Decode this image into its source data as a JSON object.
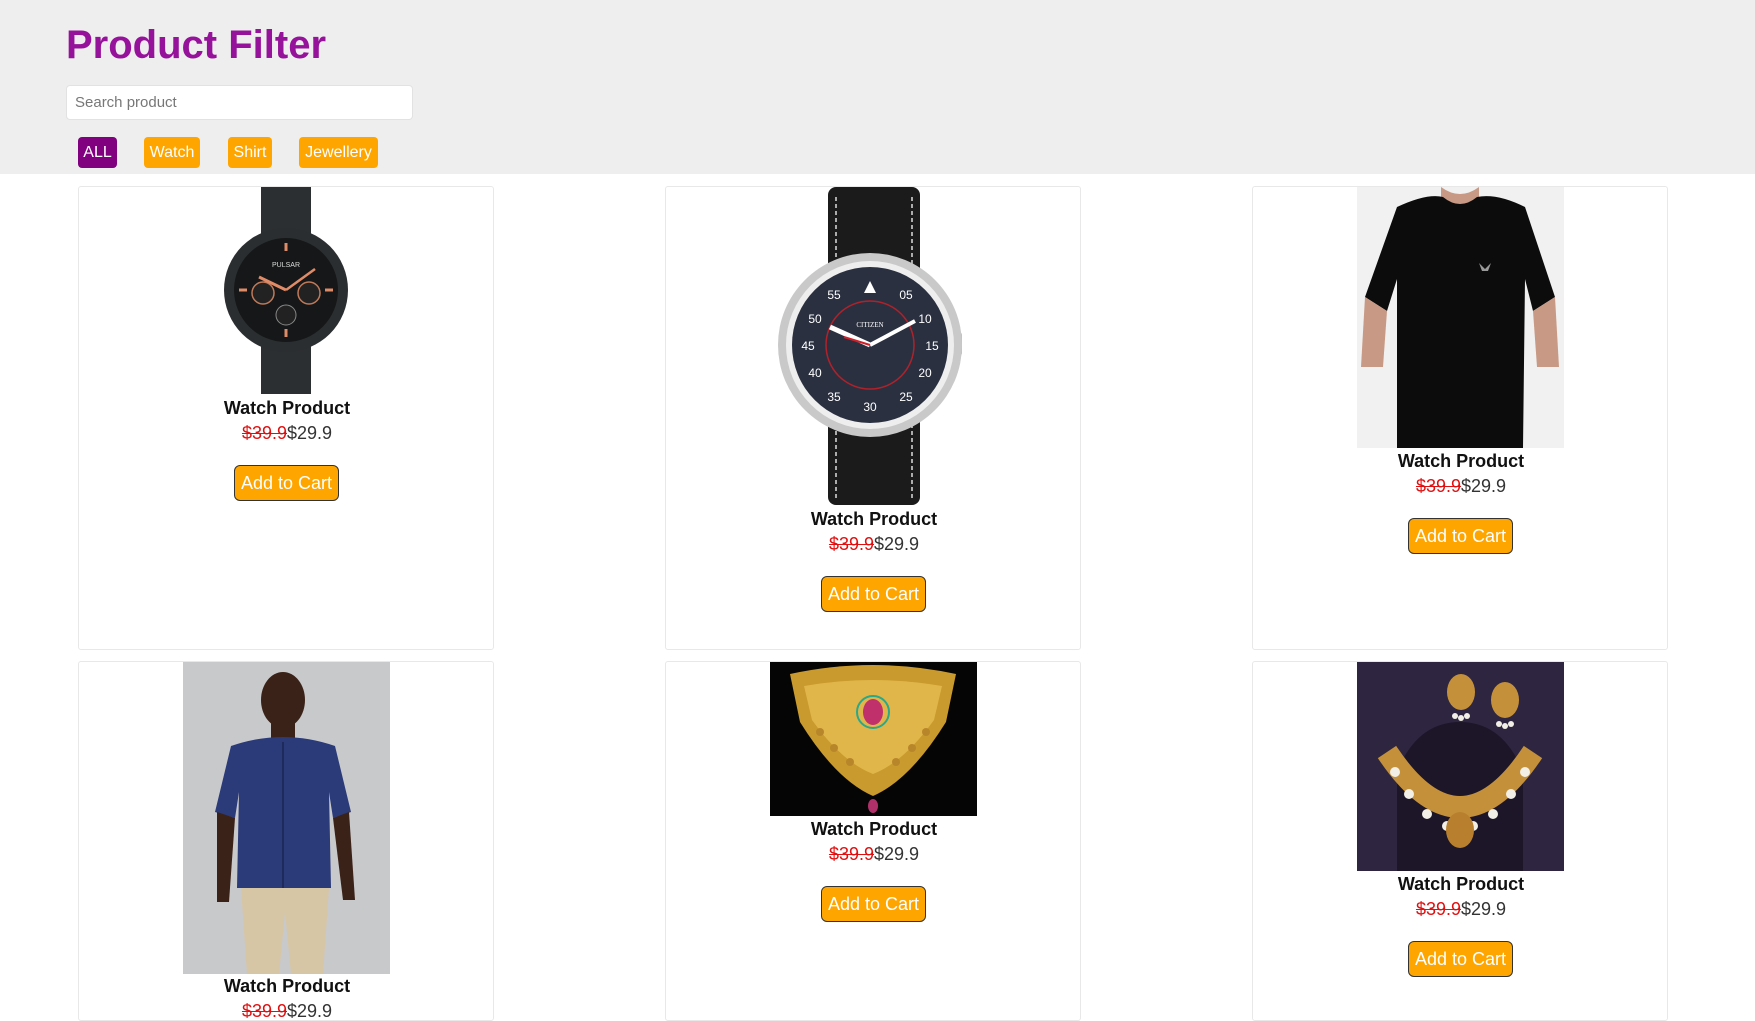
{
  "header": {
    "title": "Product Filter",
    "search_placeholder": "Search product",
    "search_value": ""
  },
  "filters": [
    {
      "label": "ALL",
      "active": true
    },
    {
      "label": "Watch",
      "active": false
    },
    {
      "label": "Shirt",
      "active": false
    },
    {
      "label": "Jewellery",
      "active": false
    }
  ],
  "colors": {
    "title": "#96129a",
    "active_filter": "#800080",
    "filter": "#ffa500",
    "button": "#ffa500",
    "old_price": "#e01010",
    "header_bg": "#eeeeef"
  },
  "products": [
    {
      "name": "Watch Product",
      "old_price": "$39.9",
      "price": "$29.9",
      "button": "Add to Cart",
      "image": "black-chronograph-watch"
    },
    {
      "name": "Watch Product",
      "old_price": "$39.9",
      "price": "$29.9",
      "button": "Add to Cart",
      "image": "pilot-watch-leather-strap"
    },
    {
      "name": "Watch Product",
      "old_price": "$39.9",
      "price": "$29.9",
      "button": "Add to Cart",
      "image": "black-t-shirt"
    },
    {
      "name": "Watch Product",
      "old_price": "$39.9",
      "price": "$29.9",
      "button": "Add to Cart",
      "image": "blue-shirt-model"
    },
    {
      "name": "Watch Product",
      "old_price": "$39.9",
      "price": "$29.9",
      "button": "Add to Cart",
      "image": "gold-choker-necklace"
    },
    {
      "name": "Watch Product",
      "old_price": "$39.9",
      "price": "$29.9",
      "button": "Add to Cart",
      "image": "gold-pearl-necklace-set"
    }
  ]
}
